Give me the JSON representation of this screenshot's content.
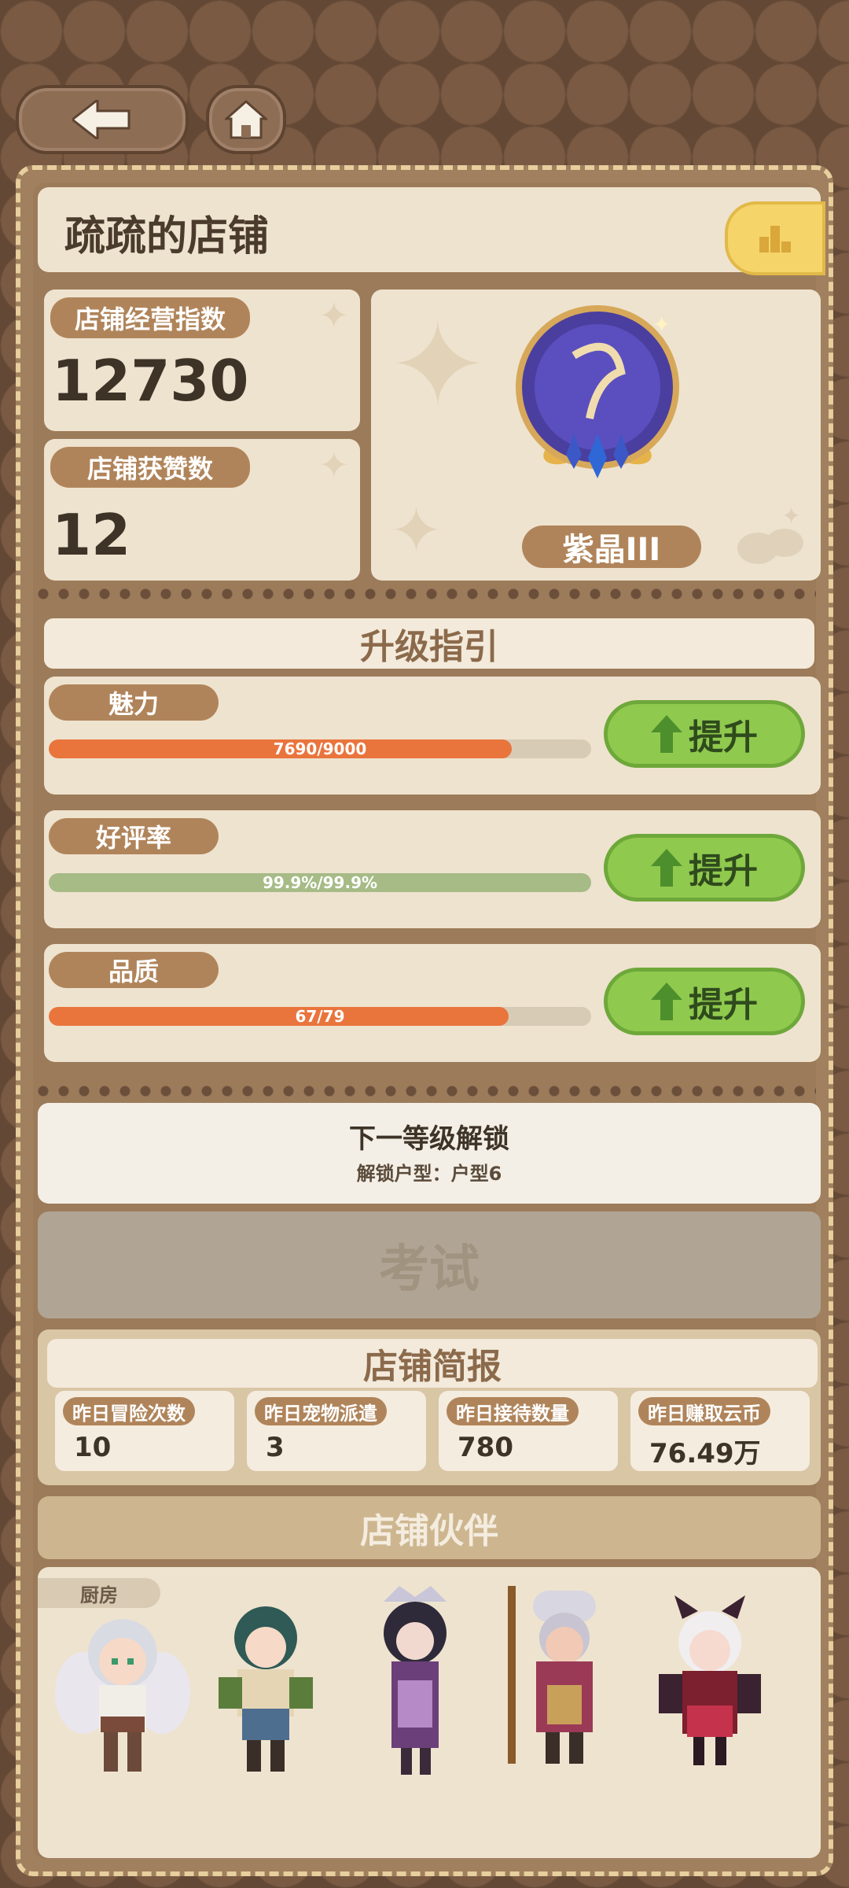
{
  "nav": {
    "back_icon": "arrow-left-icon",
    "home_icon": "home-icon"
  },
  "shop": {
    "title": "疏疏的店铺",
    "rank_icon": "podium-icon"
  },
  "stats": {
    "operate_label": "店铺经营指数",
    "operate_value": "12730",
    "likes_label": "店铺获赞数",
    "likes_value": "12"
  },
  "badge": {
    "tier": "紫晶III"
  },
  "guide": {
    "title": "升级指引",
    "items": [
      {
        "label": "魅力",
        "text": "7690/9000",
        "progress": 0.854,
        "color": "#e9753d",
        "button": "提升"
      },
      {
        "label": "好评率",
        "text": "99.9%/99.9%",
        "progress": 1.0,
        "color": "#a6bb86",
        "button": "提升"
      },
      {
        "label": "品质",
        "text": "67/79",
        "progress": 0.848,
        "color": "#e9753d",
        "button": "提升"
      }
    ]
  },
  "unlock": {
    "title": "下一等级解锁",
    "detail": "解锁户型：户型6"
  },
  "exam": {
    "label": "考试"
  },
  "report": {
    "title": "店铺简报",
    "items": [
      {
        "label": "昨日冒险次数",
        "value": "10"
      },
      {
        "label": "昨日宠物派遣",
        "value": "3"
      },
      {
        "label": "昨日接待数量",
        "value": "780"
      },
      {
        "label": "昨日赚取云币",
        "value": "76.49万"
      }
    ]
  },
  "partners": {
    "title": "店铺伙伴",
    "role_tag": "厨房",
    "list": [
      "partner-elf",
      "partner-warrior",
      "partner-sorceress",
      "partner-elder",
      "partner-demon"
    ]
  },
  "colors": {
    "accent_green": "#8fc94e",
    "progress_orange": "#e9753d",
    "pill_brown": "#b0845a"
  }
}
